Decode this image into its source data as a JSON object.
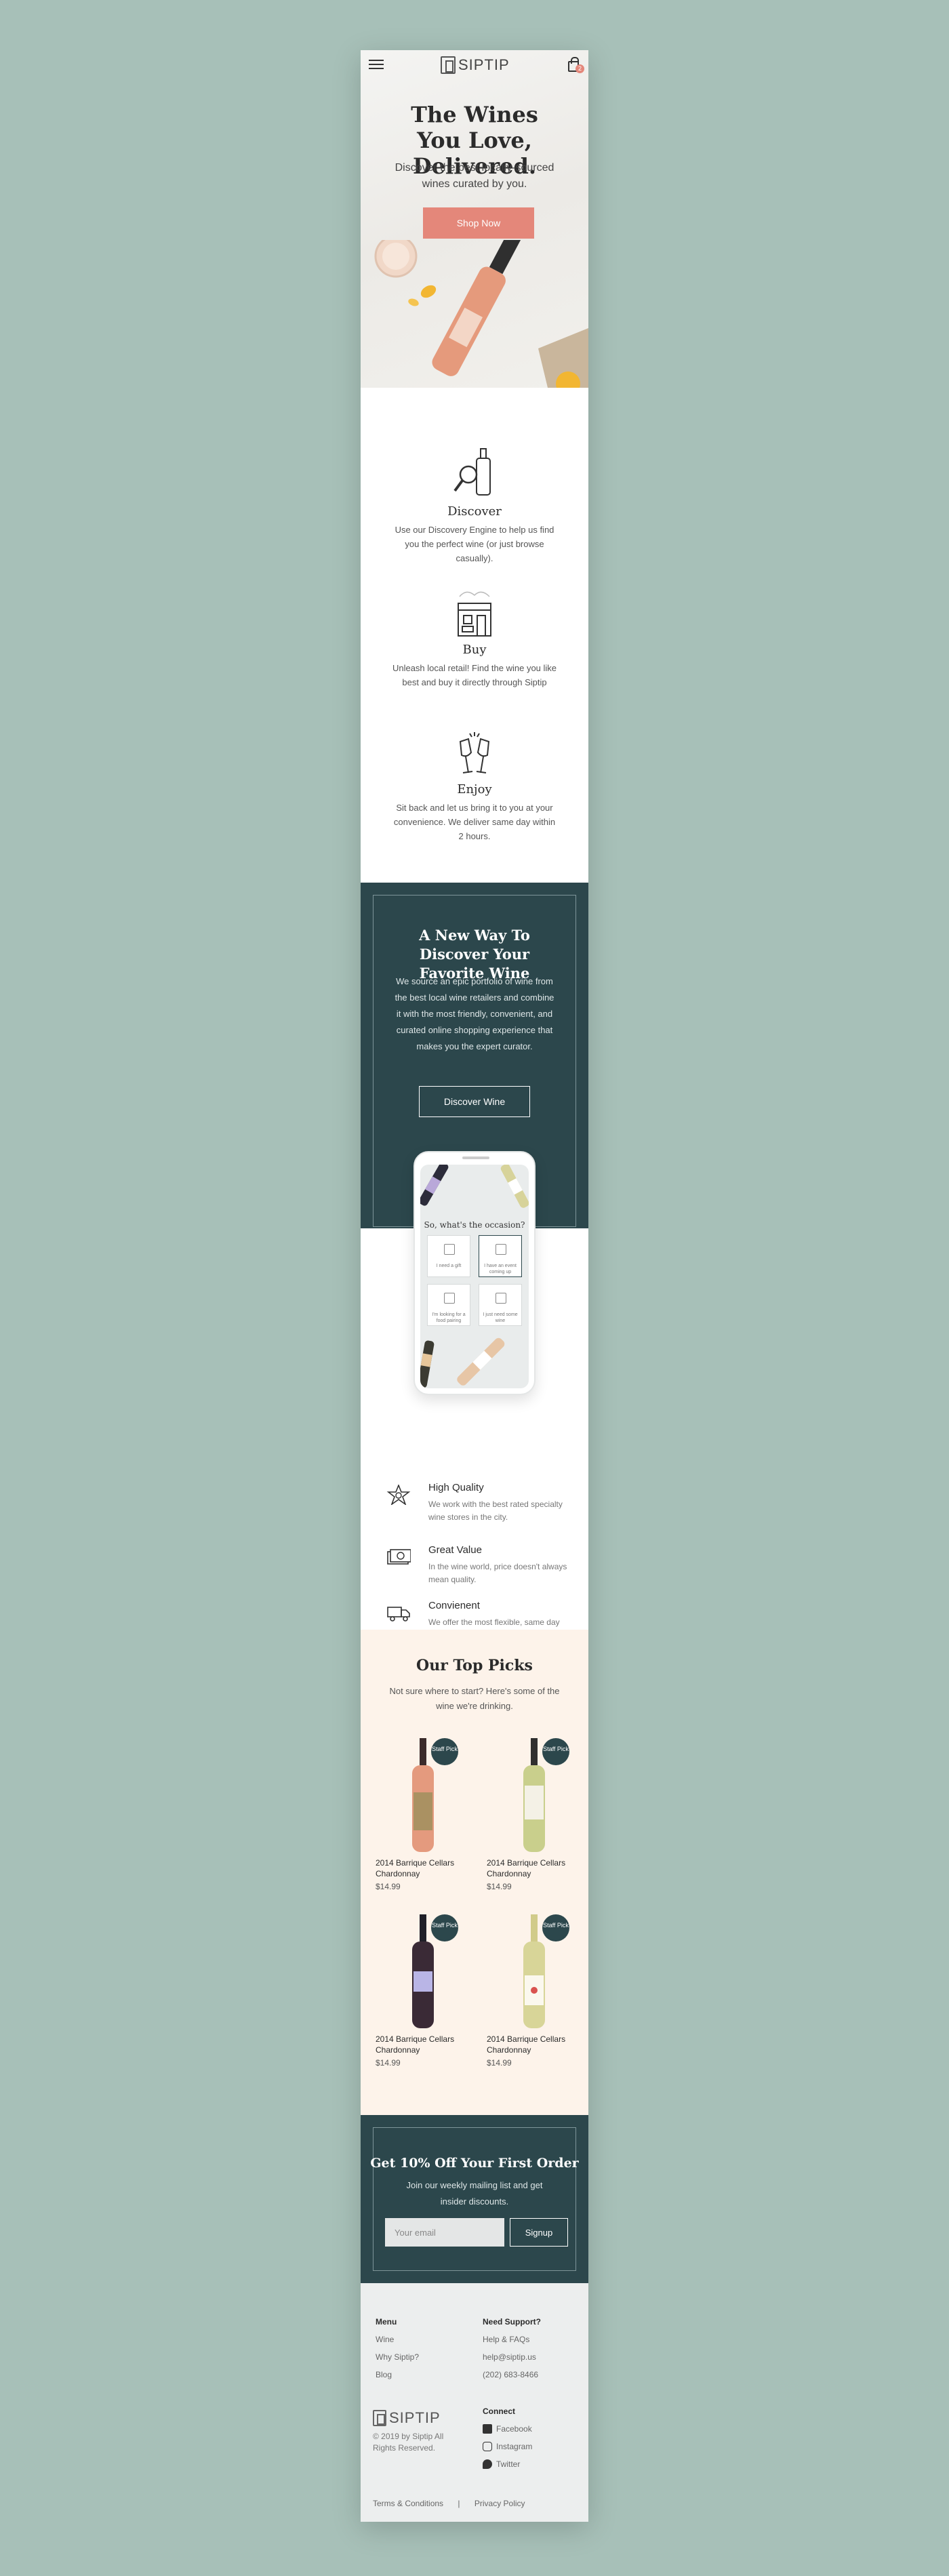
{
  "header": {
    "brand": "SIPTIP",
    "cart_count": "2"
  },
  "hero": {
    "title": "The Wines You Love, Delivered.",
    "subtitle": "Discover the best locally-sourced wines curated by you.",
    "cta": "Shop Now"
  },
  "steps": [
    {
      "title": "Discover",
      "body": "Use our Discovery Engine to help us find you the perfect wine (or just browse casually)."
    },
    {
      "title": "Buy",
      "body": "Unleash local retail! Find the wine you like best and buy it directly through Siptip"
    },
    {
      "title": "Enjoy",
      "body": "Sit back and let us bring it to you at your convenience. We deliver same day within 2 hours."
    }
  ],
  "new_way": {
    "title": "A New Way To Discover Your Favorite Wine",
    "body": "We source an epic portfolio of wine from the best local wine retailers and combine it with the most friendly, convenient, and curated online shopping experience that makes you the expert curator.",
    "cta": "Discover Wine"
  },
  "phone": {
    "question": "So, what's the occasion?",
    "options": [
      "I need a gift",
      "I have an event coming up",
      "I'm looking for a food pairing",
      "I just need some wine"
    ]
  },
  "features": [
    {
      "title": "High Quality",
      "body": "We work with the best rated specialty wine stores in the city."
    },
    {
      "title": "Great Value",
      "body": "In the wine world, price doesn't always mean quality."
    },
    {
      "title": "Convienent",
      "body": "We offer the most flexible, same day delivery available"
    }
  ],
  "picks": {
    "title": "Our Top Picks",
    "subtitle": "Not sure where to start? Here's some of the wine we're drinking.",
    "badge": "Staff Pick",
    "items": [
      {
        "name": "2014 Barrique Cellars Chardonnay",
        "price": "$14.99",
        "color": "#e49a7e"
      },
      {
        "name": "2014 Barrique Cellars Chardonnay",
        "price": "$14.99",
        "color": "#c9cf8c"
      },
      {
        "name": "2014 Barrique Cellars Chardonnay",
        "price": "$14.99",
        "color": "#3a2a36"
      },
      {
        "name": "2014 Barrique Cellars Chardonnay",
        "price": "$14.99",
        "color": "#d8d598"
      }
    ]
  },
  "signup": {
    "title": "Get 10% Off Your First Order",
    "body": "Join our weekly mailing list and get insider discounts.",
    "placeholder": "Your email",
    "cta": "Signup"
  },
  "footer": {
    "menu_title": "Menu",
    "menu": [
      "Wine",
      "Why Siptip?",
      "Blog"
    ],
    "support_title": "Need Support?",
    "support": [
      "Help & FAQs",
      "help@siptip.us",
      "(202) 683-8466"
    ],
    "connect_title": "Connect",
    "social": [
      "Facebook",
      "Instagram",
      "Twitter"
    ],
    "brand": "SIPTIP",
    "copyright": "© 2019 by Siptip All Rights Reserved.",
    "terms": "Terms & Conditions",
    "separator": "|",
    "privacy": "Privacy Policy"
  },
  "colors": {
    "accent": "#e4877a",
    "dark_teal": "#2c474c",
    "cream": "#fdf3ea",
    "page_bg": "#a7c0b8"
  }
}
